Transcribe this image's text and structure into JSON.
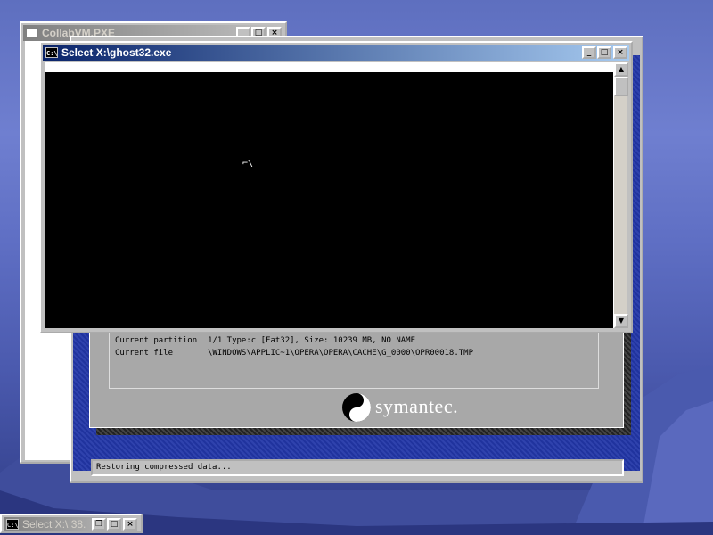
{
  "desktop": {
    "background_color": "#5e6fbf"
  },
  "collab_window": {
    "title": "CollabVM.PXE",
    "buttons": {
      "minimize": "_",
      "maximize": "□",
      "close": "×"
    }
  },
  "ghost_window": {
    "rows": [
      {
        "label": "Current partition",
        "value": "1/1 Type:c [Fat32], Size: 10239 MB, NO NAME"
      },
      {
        "label": "Current file",
        "value": "\\WINDOWS\\APPLIC~1\\OPERA\\OPERA\\CACHE\\G_0000\\OPR00018.TMP"
      }
    ],
    "brand": "symantec.",
    "status": "Restoring compressed data..."
  },
  "console_window": {
    "icon_text": "C:\\",
    "title": "Select X:\\ghost32.exe",
    "buttons": {
      "minimize": "_",
      "maximize": "□",
      "close": "×"
    },
    "cursor_glyph": "⌐\\"
  },
  "taskbar": {
    "icon_text": "C:\\",
    "item_title": "Select X:\\ 38."
  }
}
